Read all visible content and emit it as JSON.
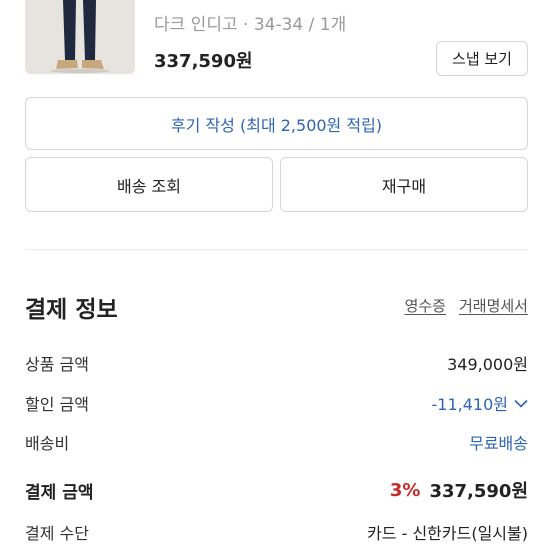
{
  "product": {
    "option": "다크 인디고 · 34-34 / 1개",
    "price": "337,590원",
    "snap_label": "스냅 보기"
  },
  "actions": {
    "review_label": "후기 작성 (최대 2,500원 적립)",
    "delivery_label": "배송 조회",
    "reorder_label": "재구매"
  },
  "payment": {
    "title": "결제 정보",
    "receipt_label": "영수증",
    "statement_label": "거래명세서",
    "rows": {
      "product_amount": {
        "label": "상품 금액",
        "value": "349,000원"
      },
      "discount_amount": {
        "label": "할인 금액",
        "value": "-11,410원"
      },
      "shipping": {
        "label": "배송비",
        "value": "무료배송"
      },
      "total": {
        "label": "결제 금액",
        "rate": "3%",
        "value": "337,590원"
      },
      "method": {
        "label": "결제 수단",
        "value": "카드 - 신한카드(일시불)"
      }
    }
  },
  "colors": {
    "link_blue": "#2e64b6",
    "discount_red": "#c62b2b",
    "border": "#d6d6d6"
  }
}
